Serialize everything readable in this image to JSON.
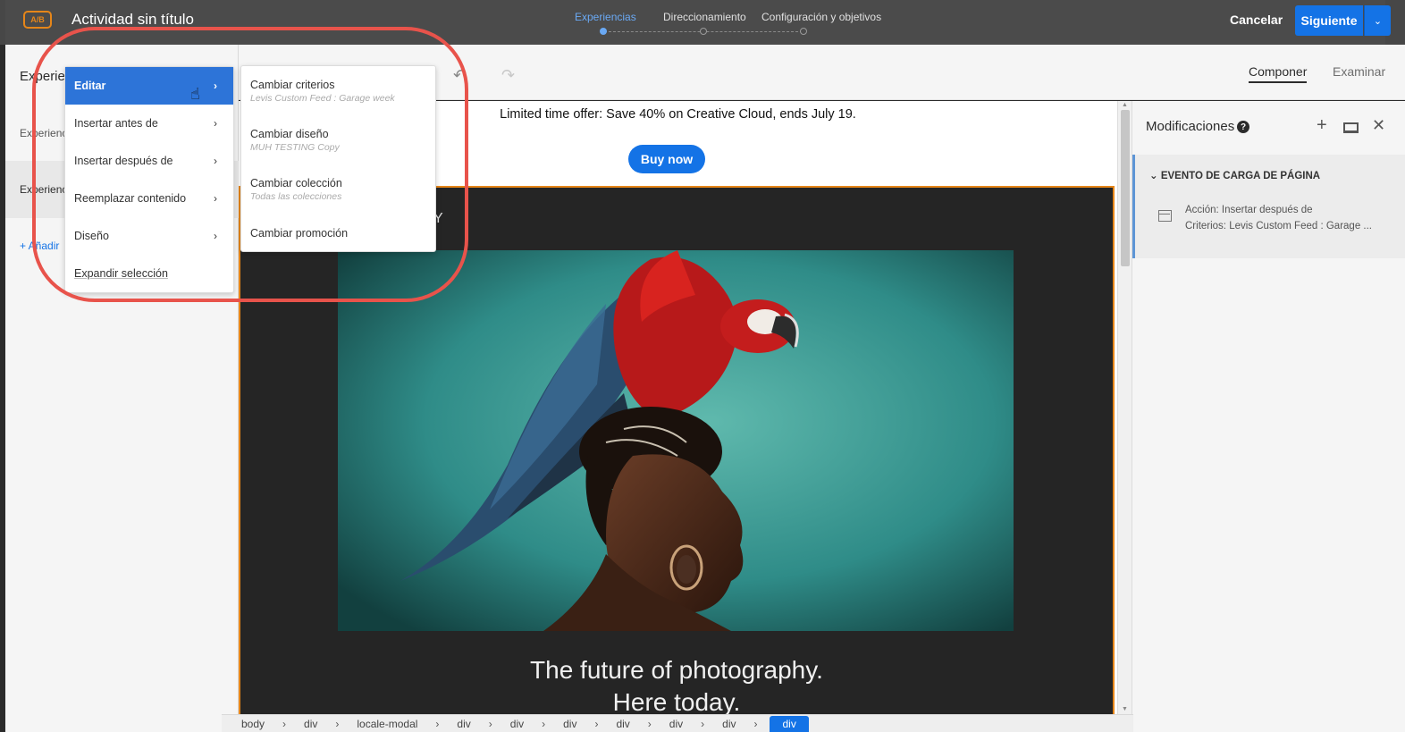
{
  "header": {
    "badge": "A/B",
    "activity_title": "Actividad sin título",
    "steps": [
      {
        "label": "Experiencias"
      },
      {
        "label": "Direccionamiento"
      },
      {
        "label": "Configuración y objetivos"
      }
    ],
    "cancel_label": "Cancelar",
    "next_label": "Siguiente",
    "next_dropdown_icon": "chevron-down"
  },
  "left_panel": {
    "heading": "Experie",
    "items": [
      {
        "label": "Experienc"
      },
      {
        "label": "Experienc"
      }
    ],
    "add_label": "+ Añadir"
  },
  "canvas_toolbar": {
    "compose_tab": "Componer",
    "browse_tab": "Examinar"
  },
  "context_menu": {
    "items": [
      {
        "label": "Editar"
      },
      {
        "label": "Insertar antes de"
      },
      {
        "label": "Insertar después de"
      },
      {
        "label": "Reemplazar contenido"
      },
      {
        "label": "Diseño"
      },
      {
        "label": "Expandir selección"
      }
    ],
    "submenu": [
      {
        "label": "Cambiar criterios",
        "desc": "Levis Custom Feed : Garage week"
      },
      {
        "label": "Cambiar diseño",
        "desc": "MUH TESTING Copy"
      },
      {
        "label": "Cambiar colección",
        "desc": "Todas las colecciones"
      },
      {
        "label": "Cambiar promoción",
        "desc": ""
      }
    ]
  },
  "page_preview": {
    "promo_text": "Limited time offer: Save 40% on Creative Cloud, ends July 19.",
    "buy_button": "Buy now",
    "hero_partial_text": "Y",
    "hero_line1": "The future of photography.",
    "hero_line2": "Here today."
  },
  "right_panel": {
    "title": "Modificaciones",
    "help": "?",
    "event_title": "EVENTO DE CARGA DE PÁGINA",
    "action_line1": "Acción: Insertar después de",
    "action_line2": "Criterios: Levis Custom Feed : Garage ..."
  },
  "dom_path": {
    "crumbs": [
      "body",
      "div",
      "locale-modal",
      "div",
      "div",
      "div",
      "div",
      "div",
      "div"
    ],
    "current": "div"
  },
  "colors": {
    "accent_blue": "#1473e6",
    "highlight_red": "#e8534b",
    "selection_orange": "#e68619"
  }
}
